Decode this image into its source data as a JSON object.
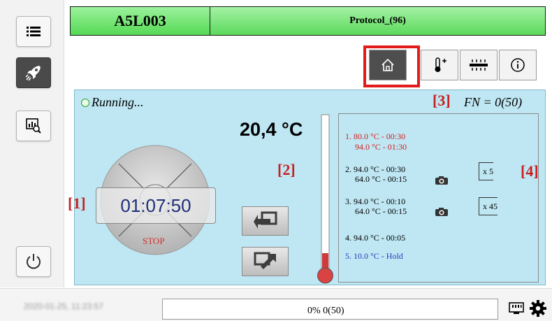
{
  "sidebar": {
    "buttons": [
      {
        "name": "menu-list-icon"
      },
      {
        "name": "rocket-icon",
        "active": true
      },
      {
        "name": "chart-search-icon"
      },
      {
        "name": "power-icon"
      }
    ]
  },
  "header": {
    "instrument_id": "A5L003",
    "protocol_name": "Protocol_(96)",
    "accent": "#6ee06e"
  },
  "tabs": [
    {
      "name": "home-icon",
      "active": true
    },
    {
      "name": "thermometer-plus-icon",
      "active": false
    },
    {
      "name": "heater-lid-icon",
      "active": false
    },
    {
      "name": "info-icon",
      "active": false
    }
  ],
  "run": {
    "status": "Running...",
    "fn_label": "FN = 0(50)",
    "temperature": "20,4 °C",
    "timer": "01:07:50",
    "stop_label": "STOP",
    "thermometer_level": 0.1
  },
  "annotations": {
    "a1": "[1]",
    "a2": "[2]",
    "a3": "[3]",
    "a4": "[4]"
  },
  "steps": [
    {
      "line1": "1. 80.0 °C - 00:30",
      "line2": "94.0 °C - 01:30",
      "color": "#d02020"
    },
    {
      "line1": "2. 94.0 °C - 00:30",
      "line2": "64.0 °C - 00:15",
      "repeat": "x 5",
      "camera": true
    },
    {
      "line1": "3. 94.0 °C - 00:10",
      "line2": "64.0 °C - 00:15",
      "repeat": "x 45",
      "camera": true
    },
    {
      "line1": "4. 94.0 °C - 00:05"
    },
    {
      "line1": "5. 10.0 °C - Hold",
      "color": "#1f3fbf"
    }
  ],
  "statusbar": {
    "datetime": "2020-01-25, 11:23:57",
    "progress_percent": 0,
    "progress_text": "0%  0(50)",
    "icons": [
      "ethernet-icon",
      "settings-gear-icon"
    ]
  }
}
